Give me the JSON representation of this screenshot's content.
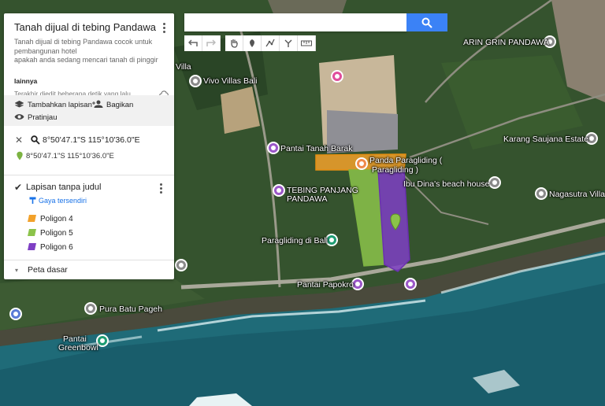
{
  "colors": {
    "sea": "#1f6b78",
    "land": "#37562f",
    "orange_poly": "#f2a12a",
    "green_poly": "#8bc34a",
    "purple_poly": "#7e3fc4",
    "accent": "#1a73e8",
    "search_button": "#3b82f6"
  },
  "panel": {
    "title": "Tanah dijual di tebing Pandawa c...",
    "description_lines": [
      "Tanah dijual di tebing Pandawa cocok untuk",
      "pembangunan hotel",
      "apakah anda sedang mencari tanah di pinggir"
    ],
    "more": "lainnya",
    "edited": "Terakhir diedit beberapa detik yang lalu",
    "add_layer": "Tambahkan lapisan",
    "share": "Bagikan",
    "preview": "Pratinjau",
    "search_result": "8°50'47.1\"S 115°10'36.0\"E",
    "marker_coord": "8°50'47.1\"S 115°10'36.0\"E",
    "layer_title": "Lapisan tanpa judul",
    "style_link": "Gaya tersendiri",
    "polygons": [
      "Poligon 4",
      "Poligon 5",
      "Poligon 6"
    ],
    "basemap": "Peta dasar"
  },
  "search": {
    "placeholder": ""
  },
  "toolbar": [
    "undo-icon",
    "redo-icon",
    "hand-icon",
    "marker-icon",
    "draw-line-icon",
    "directions-icon",
    "ruler-icon"
  ],
  "places": [
    "Vivo Villas Bali",
    "ARIN GRIN PANDAWA",
    "Pantai Tanah Barak",
    "Panda Paragliding (",
    "Paragliding )",
    "Karang Saujana Estate",
    "Ibu Dina's beach house",
    "TEBING PANJANG",
    "PANDAWA",
    "Nagasutra Villa",
    "Paragliding di Bali",
    "Pantai Papokro",
    "Pura Batu Pageh",
    "Pantai",
    "Greenbowl",
    "Villa"
  ]
}
